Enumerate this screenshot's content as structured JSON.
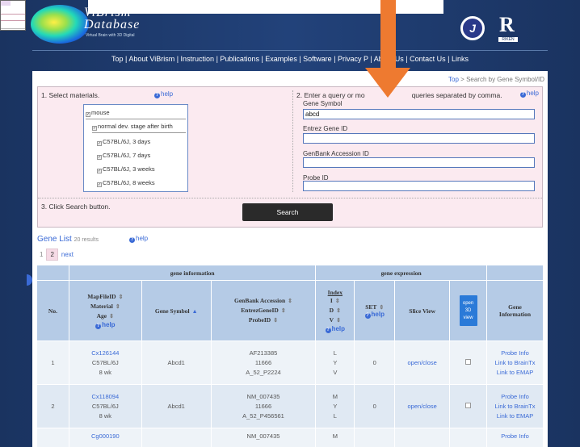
{
  "header": {
    "title_line1": "ViBrism",
    "title_line2": "Database",
    "tagline": "Virtual Brain with 3D Digital",
    "logo_right_label": "RIKEN"
  },
  "nav": [
    "Top",
    "About ViBrism",
    "Instruction",
    "Publications",
    "Examples",
    "Software",
    "Privacy P",
    "About Us",
    "Contact Us",
    "Links"
  ],
  "breadcrumb": {
    "top": "Top",
    "sep": ">",
    "current": "Search by Gene Symbol/ID"
  },
  "step1": {
    "label": "1. Select materials.",
    "help": "help",
    "materials": [
      {
        "label": "mouse"
      },
      {
        "label": "normal dev. stage after birth"
      },
      {
        "label": "C57BL/6J, 3 days"
      },
      {
        "label": "C57BL/6J, 7 days"
      },
      {
        "label": "C57BL/6J, 3 weeks"
      },
      {
        "label": "C57BL/6J, 8 weeks"
      }
    ]
  },
  "step2": {
    "label": "2. Enter a query or mo",
    "label_tail": "queries separated by comma.",
    "help": "help",
    "fields": [
      {
        "label": "Gene Symbol",
        "value": "abcd"
      },
      {
        "label": "Entrez Gene ID",
        "value": ""
      },
      {
        "label": "GenBank Accession ID",
        "value": ""
      },
      {
        "label": "Probe ID",
        "value": ""
      }
    ]
  },
  "step3": {
    "label": "3. Click Search button.",
    "button": "Search"
  },
  "gene_list": {
    "title": "Gene List",
    "count": "20 results",
    "help": "help",
    "pages": [
      "1",
      "2"
    ],
    "next": "next"
  },
  "table": {
    "group_headers": {
      "info": "gene information",
      "expr": "gene expression"
    },
    "headers": {
      "no": "No.",
      "mapfile": [
        "MapFileID",
        "Material",
        "Age"
      ],
      "help": "help",
      "symbol": "Gene Symbol",
      "genbank": [
        "GenBank Accession",
        "EntrezGeneID",
        "ProbeID"
      ],
      "index_title": "Index",
      "index_letters": [
        "I",
        "D",
        "V"
      ],
      "set": "SET",
      "slice": "Slice View",
      "open3d": [
        "open",
        "3D",
        "view"
      ],
      "geneinfo": [
        "Gene",
        "Information"
      ]
    },
    "rows": [
      {
        "no": "1",
        "mapfile": "Cx126144",
        "material": "C57BL/6J",
        "age": "8 wk",
        "symbol": "Abcd1",
        "acc": "AF213385",
        "entrez": "11666",
        "probe": "A_52_P2224",
        "idx": [
          "L",
          "Y",
          "V"
        ],
        "set": "0",
        "slice": "open/close",
        "links": [
          "Probe Info",
          "Link to BrainTx",
          "Link to EMAP"
        ]
      },
      {
        "no": "2",
        "mapfile": "Cx118094",
        "material": "C57BL/6J",
        "age": "8 wk",
        "symbol": "Abcd1",
        "acc": "NM_007435",
        "entrez": "11666",
        "probe": "A_52_P456561",
        "idx": [
          "M",
          "Y",
          "L"
        ],
        "set": "0",
        "slice": "open/close",
        "links": [
          "Probe Info",
          "Link to BrainTx",
          "Link to EMAP"
        ]
      },
      {
        "no": "",
        "mapfile": "Cg000190",
        "material": "",
        "age": "",
        "symbol": "",
        "acc": "NM_007435",
        "entrez": "",
        "probe": "",
        "idx": [
          "M",
          "",
          ""
        ],
        "set": "",
        "slice": "",
        "links": [
          "Probe Info",
          "",
          ""
        ]
      }
    ]
  },
  "colors": {
    "arrow": "#ee7a30",
    "header_bg": "#1d3866",
    "accent": "#3a6ad6",
    "search_bg": "#fbeaf0"
  }
}
